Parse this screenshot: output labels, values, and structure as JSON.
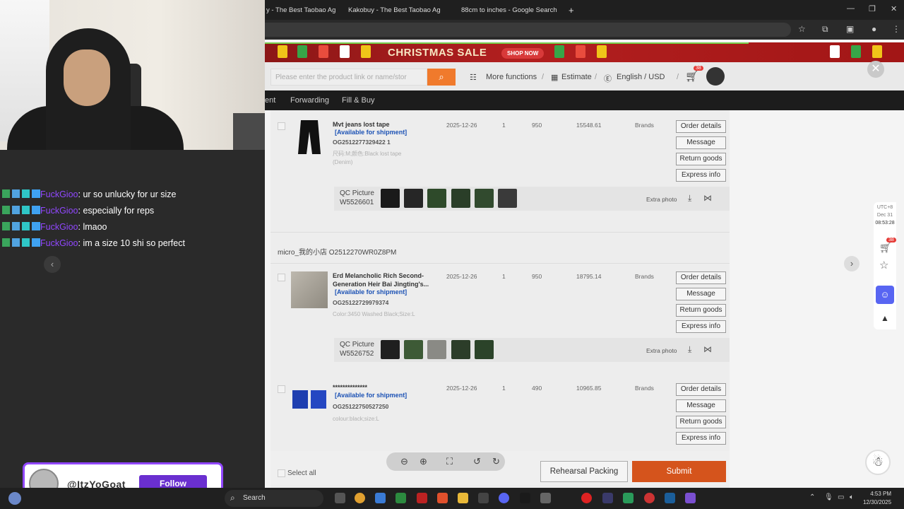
{
  "browser": {
    "tabs": [
      {
        "title": "y - The Best Taobao Ag",
        "x": 0
      },
      {
        "title": "Kakobuy - The Best Taobao Ag",
        "x": 1
      },
      {
        "title": "88cm to inches - Google Search",
        "x": 2
      }
    ],
    "new_tab": "+"
  },
  "banner": {
    "title": "CHRISTMAS SALE",
    "button": "SHOP NOW"
  },
  "search": {
    "placeholder": "Please enter the product link or name/stor",
    "more_functions": "More functions",
    "estimate": "Estimate",
    "language": "English / USD",
    "cart_count": "38"
  },
  "categories": [
    "ent",
    "Forwarding",
    "Fill & Buy"
  ],
  "orders": [
    {
      "name": "Mvt jeans lost tape",
      "availability": "[Available for shipment]",
      "og": "OG2512277329422 1",
      "variant": "尺码:M;颜色:Black lost tape (Denim)",
      "date": "2025-12-26",
      "qty": "1",
      "weight": "950",
      "price": "15548.61",
      "type": "Brands",
      "qc_label": "QC Picture",
      "qc_id": "W5526601"
    },
    {
      "store": "micro_我的小店   O2512270WR0Z8PM",
      "name": "Erd Melancholic Rich Second-Generation Heir Bai Jingting's...",
      "availability": "[Available for shipment]",
      "og": "OG25122729979374",
      "variant": "Color:3450 Washed Black;Size:L",
      "date": "2025-12-26",
      "qty": "1",
      "weight": "950",
      "price": "18795.14",
      "type": "Brands",
      "qc_label": "QC Picture",
      "qc_id": "W5526752"
    },
    {
      "name": "**************",
      "availability": "[Available for shipment]",
      "og": "OG25122750527250",
      "variant": "colour:black;size:L",
      "date": "2025-12-26",
      "qty": "1",
      "weight": "490",
      "price": "10965.85",
      "type": "Brands"
    }
  ],
  "order_buttons": [
    "Order details",
    "Message",
    "Return goods",
    "Express info"
  ],
  "extra_photo": "Extra photo",
  "footer": {
    "select_all": "Select all",
    "rehearsal": "Rehearsal Packing",
    "submit": "Submit"
  },
  "sidebar": {
    "utc": "UTC+8",
    "date": "Dec 31",
    "time": "08:53:28",
    "cart_badge": "38"
  },
  "chat": {
    "messages": [
      {
        "user": "FuckGioo",
        "text": ": ur so unlucky for ur size"
      },
      {
        "user": "FuckGioo",
        "text": ": especially for reps"
      },
      {
        "user": "FuckGioo",
        "text": ": lmaoo"
      },
      {
        "user": "FuckGioo",
        "text": ": im a size 10 shi so perfect"
      }
    ],
    "follow_handle": "@ItzYoGoat",
    "follow_label": "Follow"
  },
  "taskbar": {
    "search": "Search",
    "time": "4:53 PM",
    "date": "12/30/2025"
  },
  "colors": {
    "accent": "#d5541c",
    "twitch": "#9147ff",
    "link": "#1c52b5"
  }
}
